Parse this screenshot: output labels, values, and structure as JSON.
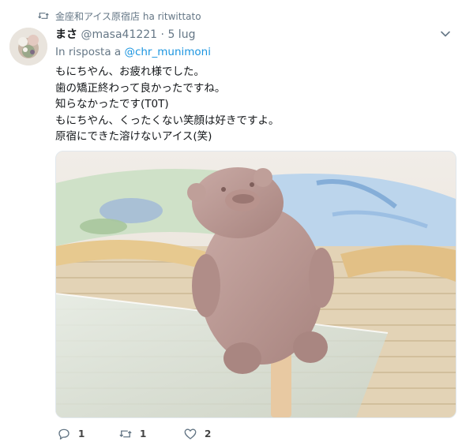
{
  "retweet_context": {
    "text": "金座和アイス原宿店 ha ritwittato",
    "icon": "retweet-icon"
  },
  "tweet": {
    "author_name": "まさ",
    "handle": "@masa41221",
    "separator": "·",
    "time": "5 lug",
    "reply_prefix": "In risposta a",
    "reply_mention": "@chr_munimoni",
    "lines": [
      "もにちやん、お疲れ様でした。",
      "歯の矯正終わって良かったですね。",
      "知らなかったです(T0T)",
      "もにちやん、くったくない笑顔は好きですよ。",
      "原宿にできた溶けないアイス(笑)"
    ]
  },
  "actions": {
    "reply": {
      "icon": "reply-icon",
      "count": "1"
    },
    "retweet": {
      "icon": "retweet-icon",
      "count": "1"
    },
    "like": {
      "icon": "heart-icon",
      "count": "2"
    }
  },
  "colors": {
    "secondary_text": "#657786",
    "link": "#1b95e0",
    "primary_text": "#14171a"
  }
}
